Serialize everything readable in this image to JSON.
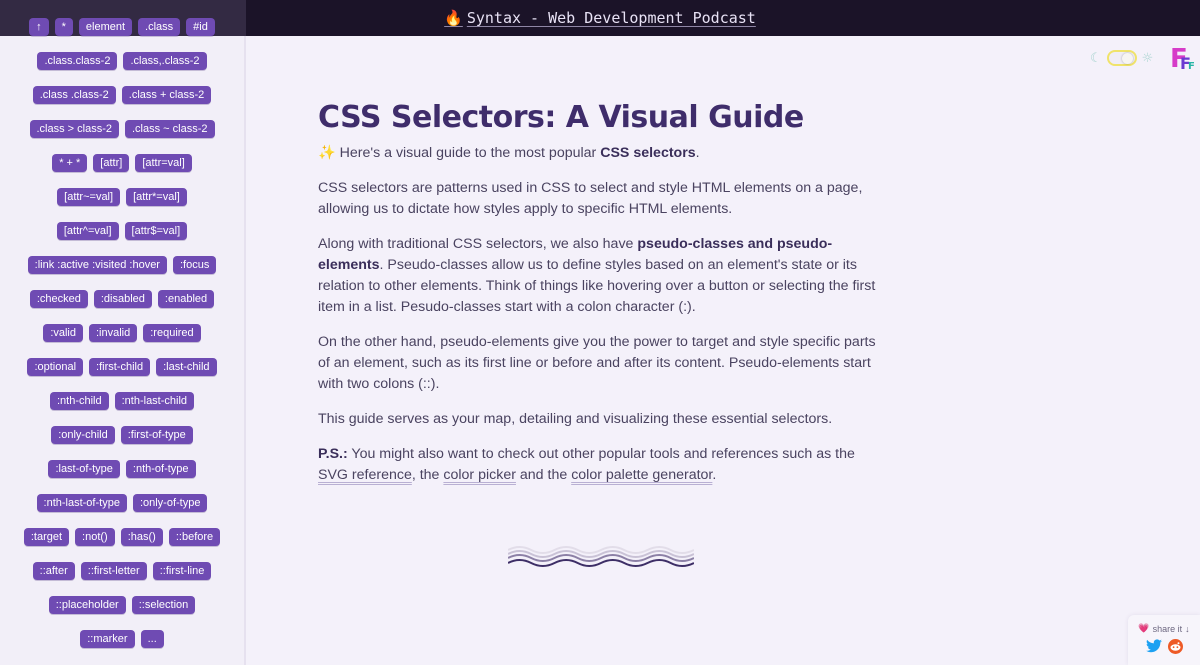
{
  "header": {
    "brand_icon": "flame-icon",
    "brand_emoji": "🔥",
    "title": "Syntax - Web Development Podcast"
  },
  "sidebar": {
    "rows": [
      [
        "↑",
        "*",
        "element",
        ".class",
        "#id"
      ],
      [
        ".class.class-2",
        ".class,.class-2"
      ],
      [
        ".class .class-2",
        ".class + class-2"
      ],
      [
        ".class > class-2",
        ".class ~ class-2"
      ],
      [
        "* + *",
        "[attr]",
        "[attr=val]"
      ],
      [
        "[attr~=val]",
        "[attr*=val]"
      ],
      [
        "[attr^=val]",
        "[attr$=val]"
      ],
      [
        ":link :active :visited :hover",
        ":focus"
      ],
      [
        ":checked",
        ":disabled",
        ":enabled"
      ],
      [
        ":valid",
        ":invalid",
        ":required"
      ],
      [
        ":optional",
        ":first-child",
        ":last-child"
      ],
      [
        ":nth-child",
        ":nth-last-child"
      ],
      [
        ":only-child",
        ":first-of-type"
      ],
      [
        ":last-of-type",
        ":nth-of-type"
      ],
      [
        ":nth-last-of-type",
        ":only-of-type"
      ],
      [
        ":target",
        ":not()",
        ":has()",
        "::before"
      ],
      [
        "::after",
        "::first-letter",
        "::first-line"
      ],
      [
        "::placeholder",
        "::selection"
      ],
      [
        "::marker",
        "..."
      ]
    ]
  },
  "theme_toggle": {
    "moon_icon": "☾",
    "sun_icon": "☼",
    "state": "light"
  },
  "logo": {
    "letters": [
      "F",
      "F",
      "F"
    ]
  },
  "main": {
    "title": "CSS Selectors: A Visual Guide",
    "intro_emoji": "✨",
    "intro_text": " Here's a visual guide to the most popular ",
    "intro_bold": "CSS selectors",
    "intro_end": ".",
    "p1": "CSS selectors are patterns used in CSS to select and style HTML elements on a page, allowing us to dictate how styles apply to specific HTML elements.",
    "p2_start": "Along with traditional CSS selectors, we also have ",
    "p2_bold": "pseudo-classes and pseudo-elements",
    "p2_end": ". Pseudo-classes allow us to define styles based on an element's state or its relation to other elements. Think of things like hovering over a button or selecting the first item in a list. Pesudo-classes start with a colon character (:).",
    "p3": "On the other hand, pseudo-elements give you the power to target and style specific parts of an element, such as its first line or before and after its content. Pseudo-elements start with two colons (::).",
    "p4": "This guide serves as your map, detailing and visualizing these essential selectors.",
    "ps_label": "P.S.:",
    "ps_text": " You might also want to check out other popular tools and references such as the ",
    "ps_link1": "SVG reference",
    "ps_sep1": ", the ",
    "ps_link2": "color picker",
    "ps_sep2": " and the ",
    "ps_link3": "color palette generator",
    "ps_end": "."
  },
  "share": {
    "label": "share it",
    "heart": "💗",
    "arrow": "↓",
    "twitter": "twitter-icon",
    "reddit": "reddit-icon"
  },
  "colors": {
    "tag_bg": "#6f4bb3",
    "title": "#3f2d6b",
    "topbar": "#1b1328"
  }
}
